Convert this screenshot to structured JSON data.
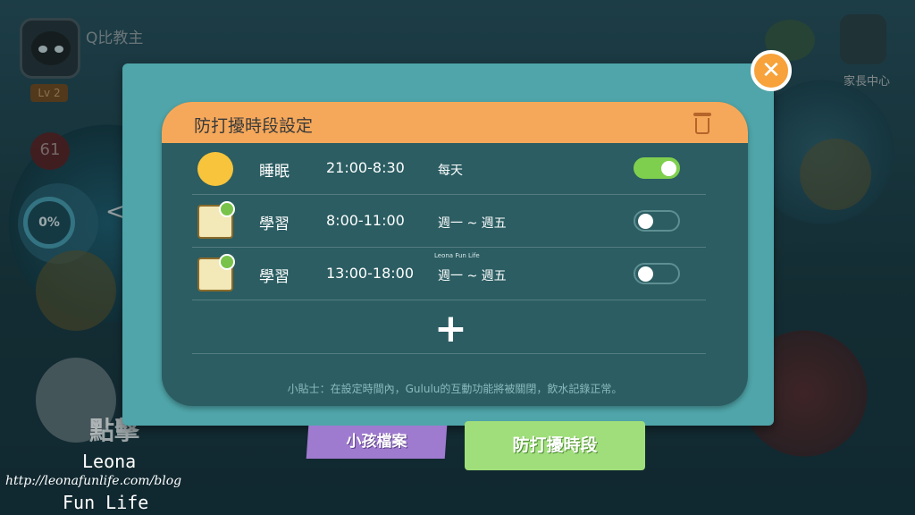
{
  "player": {
    "name": "Q比教主",
    "level": "Lv 2",
    "score": "61",
    "progress": "0%"
  },
  "top_right": {
    "parent_center": "家長中心"
  },
  "dialog": {
    "title": "防打擾時段設定",
    "rows": [
      {
        "label": "睡眠",
        "time": "21:00-8:30",
        "days": "每天",
        "enabled": true,
        "icon": "sun-icon"
      },
      {
        "label": "學習",
        "time": "8:00-11:00",
        "days": "週一 ~ 週五",
        "enabled": false,
        "icon": "book-clock-icon"
      },
      {
        "label": "學習",
        "time": "13:00-18:00",
        "days": "週一 ~ 週五",
        "enabled": false,
        "icon": "book-clock-icon"
      }
    ],
    "add_symbol": "+",
    "tip": "小貼士：在設定時間內，Gululu的互動功能將被關閉，飲水記錄正常。",
    "mini_watermark": "Leona Fun Life"
  },
  "tabs": {
    "child_profile": "小孩檔案",
    "do_not_disturb": "防打擾時段"
  },
  "background_caption": "點擊",
  "watermark": {
    "line1": "Leona",
    "url": "http://leonafunlife.com/blog",
    "line2": "Fun Life"
  },
  "colors": {
    "modal": "#4fa5a9",
    "header": "#f6a85a",
    "toggle_on": "#7fcf4f",
    "close": "#f7a23b"
  }
}
